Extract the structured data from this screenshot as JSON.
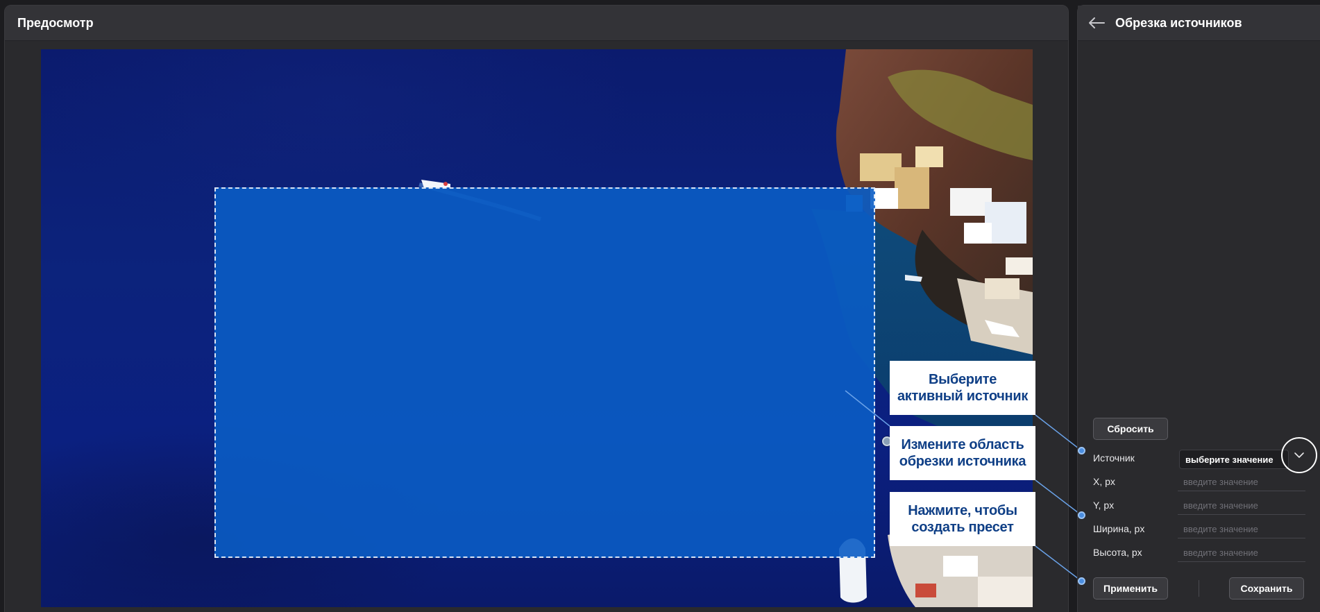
{
  "preview": {
    "title": "Предосмотр"
  },
  "callouts": [
    {
      "line1": "Выберите",
      "line2": "активный источник"
    },
    {
      "line1": "Измените область",
      "line2": "обрезки источника"
    },
    {
      "line1": "Нажмите, чтобы",
      "line2": "создать пресет"
    }
  ],
  "crop_panel": {
    "title": "Обрезка источников",
    "reset_label": "Сбросить",
    "source_label": "Источник",
    "source_select_value": "выберите значение",
    "fields": [
      {
        "label": "X, px",
        "placeholder": "введите значение"
      },
      {
        "label": "Y, px",
        "placeholder": "введите значение"
      },
      {
        "label": "Ширина, px",
        "placeholder": "введите значение"
      },
      {
        "label": "Высота, px",
        "placeholder": "введите значение"
      }
    ],
    "apply_label": "Применить",
    "save_label": "Сохранить"
  },
  "colors": {
    "accent": "#4b8ee0",
    "crop_fill": "#0a5cc4",
    "callout_text": "#0f3f86"
  }
}
